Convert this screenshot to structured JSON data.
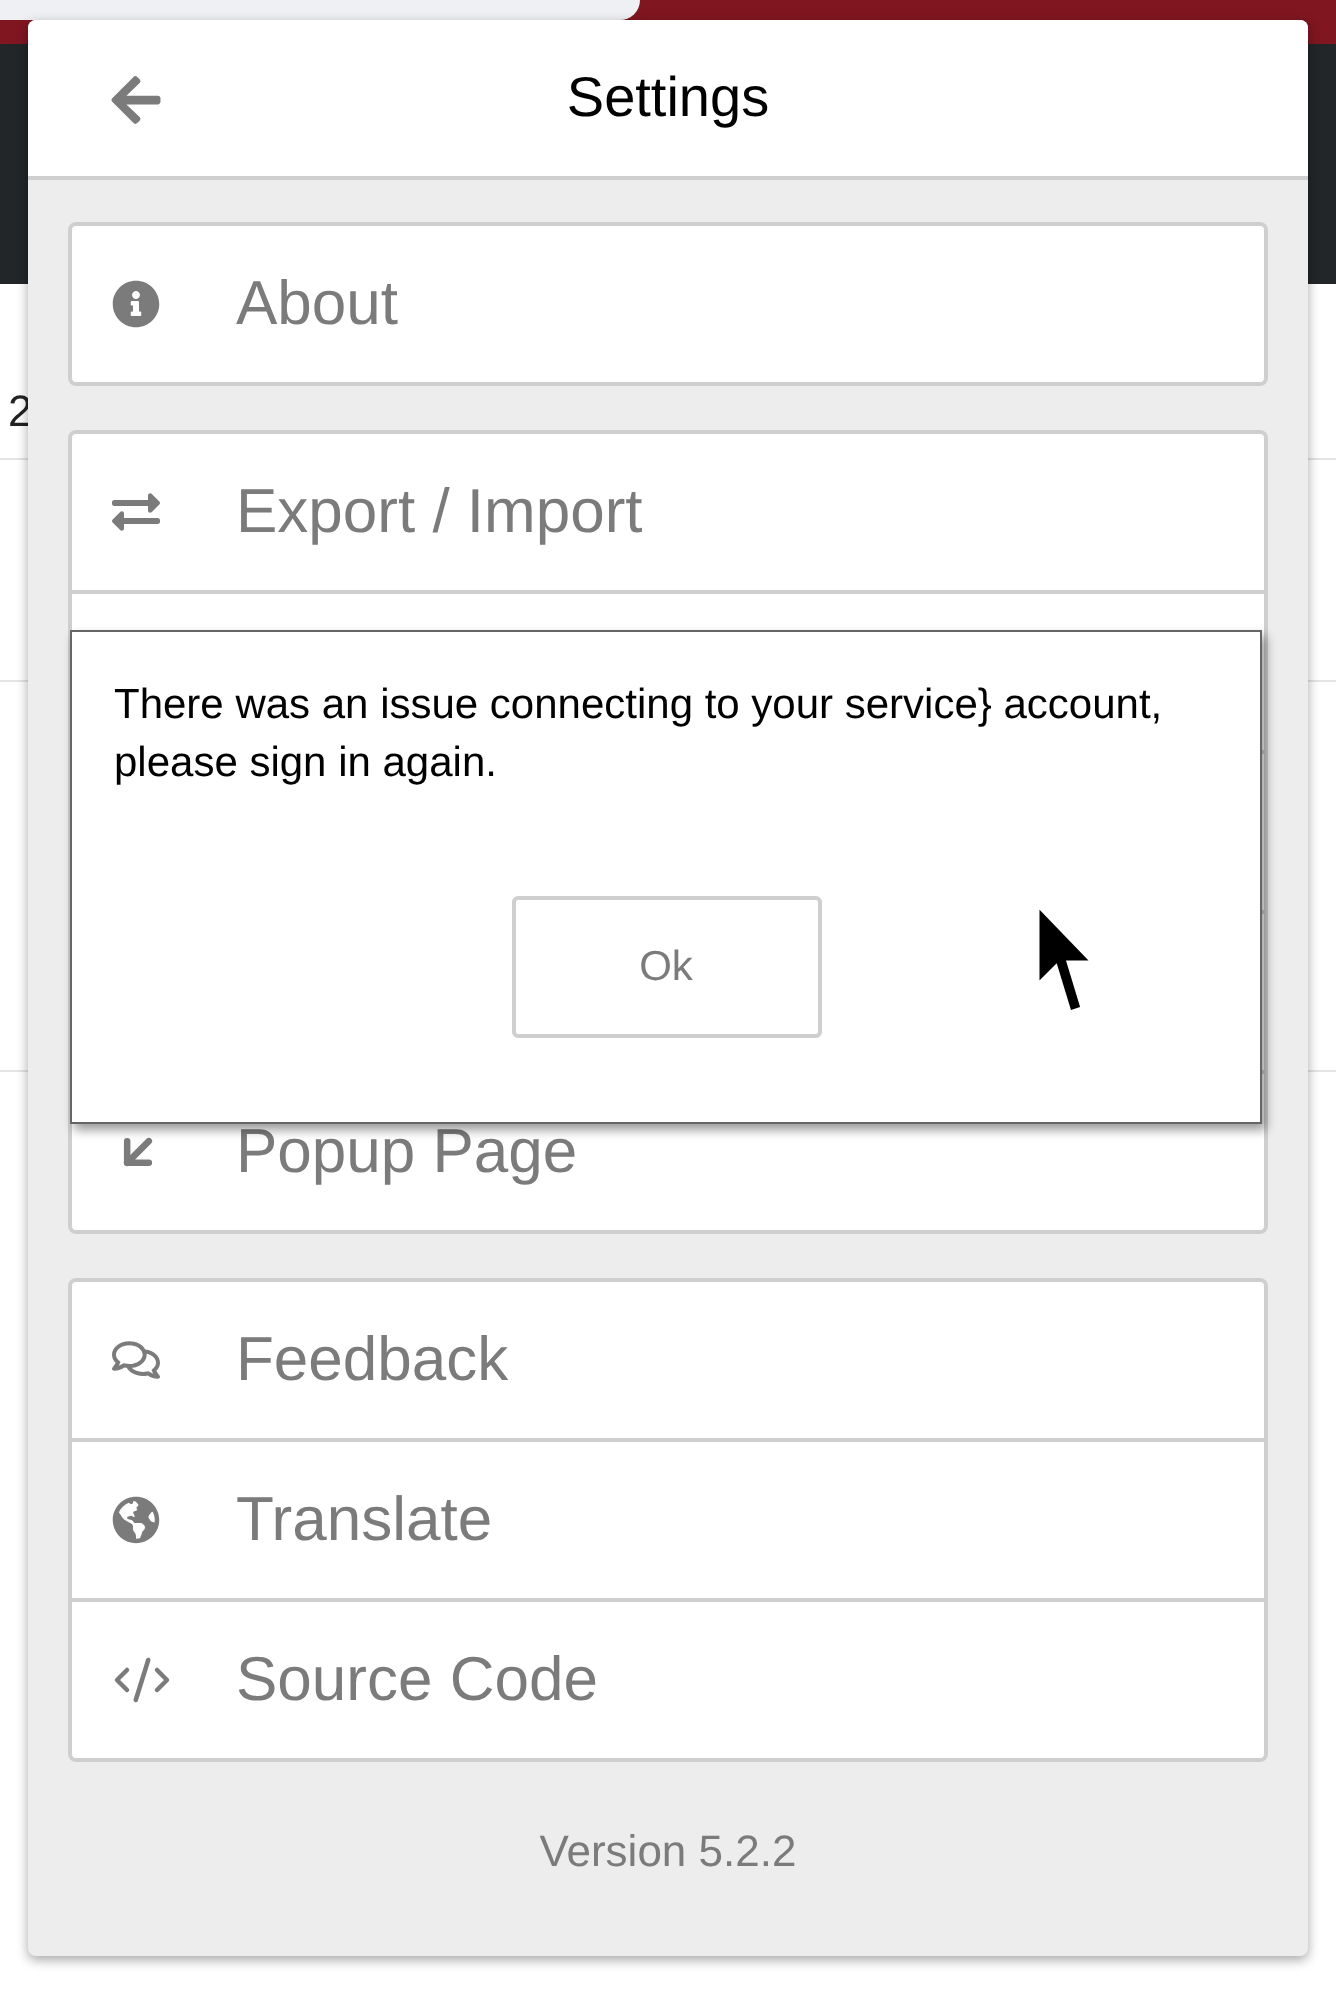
{
  "background": {
    "page_fragment": "2"
  },
  "panel": {
    "title": "Settings",
    "groups": [
      {
        "items": [
          {
            "kind": "entry",
            "label": "About"
          }
        ]
      },
      {
        "items": [
          {
            "kind": "entry",
            "label": "Export / Import"
          },
          {
            "kind": "covered"
          },
          {
            "kind": "covered"
          },
          {
            "kind": "covered"
          },
          {
            "kind": "entry",
            "label": "Popup Page"
          }
        ]
      },
      {
        "items": [
          {
            "kind": "entry",
            "label": "Feedback"
          },
          {
            "kind": "entry",
            "label": "Translate"
          },
          {
            "kind": "entry",
            "label": "Source Code"
          }
        ]
      }
    ],
    "version": "Version 5.2.2"
  },
  "dialog": {
    "message": "There was an issue connecting to your service} account, please sign in again.",
    "button": "Ok"
  }
}
